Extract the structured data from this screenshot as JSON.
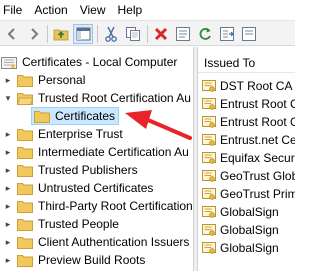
{
  "menu": [
    "File",
    "Action",
    "View",
    "Help"
  ],
  "toolbar": {
    "buttons": [
      "back-icon",
      "forward-icon",
      "up-folder-icon",
      "show-hide-tree-icon",
      "cut-icon",
      "copy-icon",
      "delete-icon",
      "properties-icon",
      "refresh-icon",
      "export-list-icon"
    ]
  },
  "tree": {
    "root": "Certificates - Local Computer",
    "personal": "Personal",
    "trusted_root": "Trusted Root Certification Au",
    "certificates": "Certificates",
    "items": [
      "Enterprise Trust",
      "Intermediate Certification Au",
      "Trusted Publishers",
      "Untrusted Certificates",
      "Third-Party Root Certification",
      "Trusted People",
      "Client Authentication Issuers",
      "Preview Build Roots"
    ]
  },
  "list": {
    "header": "Issued To",
    "rows": [
      "DST Root CA X",
      "Entrust Root C",
      "Entrust Root C",
      "Entrust.net Ce",
      "Equifax Secure",
      "GeoTrust Glob",
      "GeoTrust Prim",
      "GlobalSign",
      "GlobalSign",
      "GlobalSign"
    ]
  },
  "colors": {
    "selection": "#cce8ff",
    "arrow": "#e8232a",
    "folder": "#f2c75c"
  }
}
